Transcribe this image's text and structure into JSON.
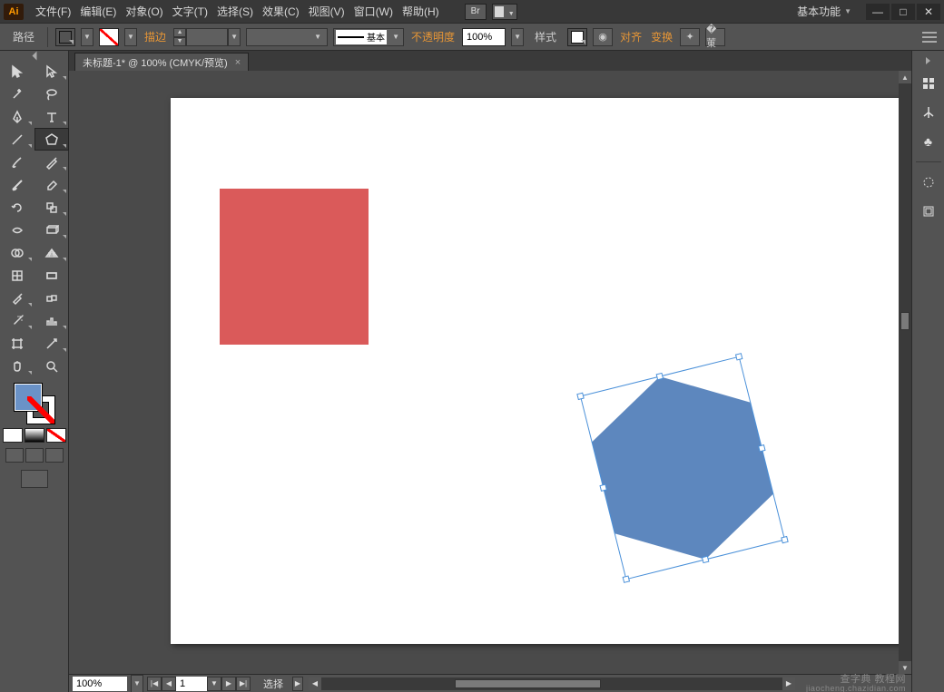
{
  "app": {
    "logo": "Ai"
  },
  "menu": {
    "file": "文件(F)",
    "edit": "编辑(E)",
    "object": "对象(O)",
    "type": "文字(T)",
    "select": "选择(S)",
    "effect": "效果(C)",
    "view": "视图(V)",
    "window": "窗口(W)",
    "help": "帮助(H)"
  },
  "bridge_label": "Br",
  "workspace": {
    "label": "基本功能"
  },
  "options": {
    "object_label": "路径",
    "fill_color": "#6a92c7",
    "stroke_label": "描边",
    "stroke_weight": "",
    "stroke_profile_label": "基本",
    "opacity_label": "不透明度",
    "opacity_value": "100%",
    "style_label": "样式",
    "align_label": "对齐",
    "transform_label": "变换"
  },
  "document": {
    "tab_title": "未标题-1* @ 100% (CMYK/预览)",
    "close": "×"
  },
  "canvas": {
    "red_square": {
      "fill": "#da5a5a"
    },
    "hexagon": {
      "fill": "#5d87be",
      "selected": true
    }
  },
  "status": {
    "zoom": "100%",
    "page": "1",
    "tool": "选择"
  },
  "watermark": {
    "line1": "查字典 教程网",
    "line2": "jiaocheng.chazidian.com"
  },
  "tools": {
    "selection": "selection",
    "direct": "direct-selection",
    "magicwand": "magic-wand",
    "lasso": "lasso",
    "pen": "pen",
    "type": "type",
    "line": "line",
    "shape": "polygon",
    "brush": "paintbrush",
    "pencil": "pencil",
    "blob": "blob-brush",
    "eraser": "eraser",
    "rotate": "rotate",
    "scale": "reflect",
    "width": "width",
    "warp": "free-transform",
    "shapebuilder": "shape-builder",
    "perspective": "live-paint",
    "mesh": "mesh",
    "gradient": "gradient",
    "eyedrop": "eyedropper",
    "blend": "blend",
    "symbol": "symbol-sprayer",
    "graph": "column-graph",
    "artboard": "artboard",
    "slice": "slice",
    "hand": "hand",
    "zoom": "zoom"
  }
}
